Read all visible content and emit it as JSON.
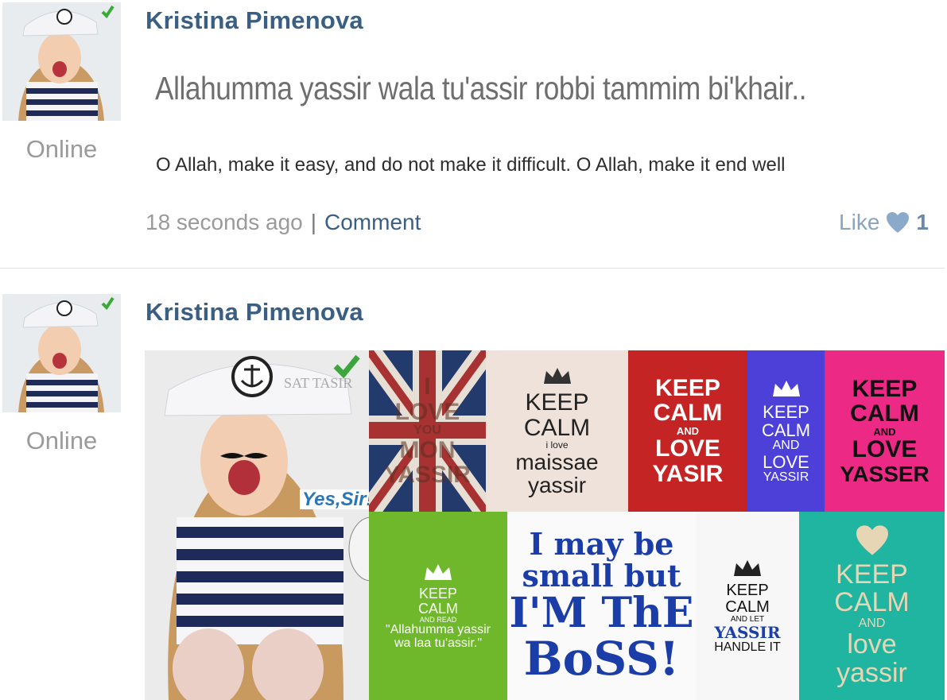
{
  "posts": [
    {
      "author": "Kristina Pimenova",
      "status": "Online",
      "quote": "Allahumma yassir wala tu'assir robbi tammim bi'khair..",
      "translation": "O Allah, make it easy, and do not make it difficult. O Allah, make it end well",
      "time": "18 seconds ago",
      "separator": "|",
      "comment_label": "Comment",
      "like_label": "Like",
      "like_count": "1"
    },
    {
      "author": "Kristina Pimenova",
      "status": "Online"
    }
  ],
  "collage": {
    "girl_hat_text": "SAT TASIR",
    "yes_sir": "Yes,Sir!",
    "tiles": [
      {
        "lines": [
          "I",
          "LOVE",
          "YOU",
          "MON",
          "YASSIR"
        ]
      },
      {
        "lines": [
          "KEEP",
          "CALM",
          "i love",
          "maissae",
          "yassir"
        ]
      },
      {
        "lines": [
          "KEEP",
          "CALM",
          "AND",
          "LOVE",
          "YASIR"
        ]
      },
      {
        "lines": [
          "KEEP",
          "CALM",
          "AND",
          "LOVE",
          "YASSIR"
        ]
      },
      {
        "lines": [
          "KEEP",
          "CALM",
          "AND",
          "LOVE",
          "YASSER"
        ]
      },
      {
        "lines": [
          "KEEP",
          "CALM",
          "AND READ",
          "\"Allahumma yassir",
          "wa laa tu'assir.\""
        ]
      },
      {
        "lines": [
          "I may be",
          "small but",
          "I'M ThE",
          "BoSS!"
        ]
      },
      {
        "lines": [
          "KEEP",
          "CALM",
          "AND LET",
          "YASSIR",
          "HANDLE IT"
        ]
      },
      {
        "lines": [
          "KEEP",
          "CALM",
          "AND",
          "love",
          "yassir"
        ]
      }
    ]
  },
  "colors": {
    "author": "#3b5f82",
    "link": "#3b5f82",
    "muted": "#9a9a9a",
    "like": "#8ba3bc"
  }
}
